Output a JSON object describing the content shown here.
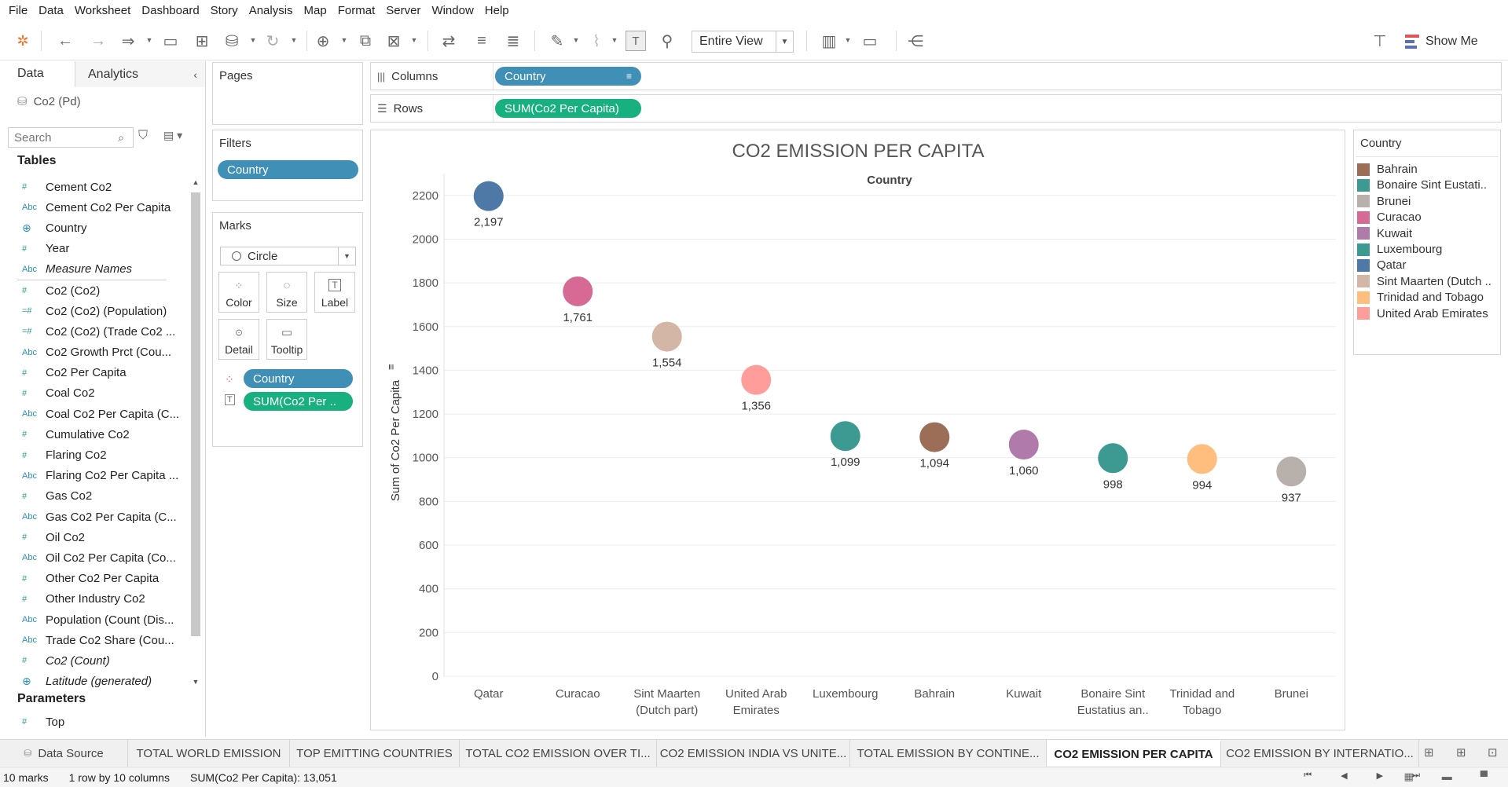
{
  "menu": [
    "File",
    "Data",
    "Worksheet",
    "Dashboard",
    "Story",
    "Analysis",
    "Map",
    "Format",
    "Server",
    "Window",
    "Help"
  ],
  "toolbar": {
    "view_select": "Entire View",
    "show_me": "Show Me"
  },
  "data_pane": {
    "tab_data": "Data",
    "tab_analytics": "Analytics",
    "datasource": "Co2 (Pd)",
    "search_placeholder": "Search",
    "tables_header": "Tables",
    "fields": [
      {
        "icon": "#",
        "type": "measure",
        "name": "Cement Co2"
      },
      {
        "icon": "Abc",
        "type": "string",
        "name": "Cement Co2 Per Capita"
      },
      {
        "icon": "geo",
        "type": "geo",
        "name": "Country"
      },
      {
        "icon": "#",
        "type": "measure",
        "name": "Year"
      },
      {
        "icon": "Abc",
        "type": "string",
        "name": "Measure Names",
        "italic": true
      },
      {
        "divider": true
      },
      {
        "icon": "#",
        "type": "measure",
        "name": "Co2 (Co2)"
      },
      {
        "icon": "=#",
        "type": "calc",
        "name": "Co2 (Co2) (Population)"
      },
      {
        "icon": "=#",
        "type": "calc",
        "name": "Co2 (Co2) (Trade Co2 ..."
      },
      {
        "icon": "Abc",
        "type": "string",
        "name": "Co2 Growth Prct (Cou..."
      },
      {
        "icon": "#",
        "type": "measure",
        "name": "Co2 Per Capita"
      },
      {
        "icon": "#",
        "type": "measure",
        "name": "Coal Co2"
      },
      {
        "icon": "Abc",
        "type": "string",
        "name": "Coal Co2 Per Capita (C..."
      },
      {
        "icon": "#",
        "type": "measure",
        "name": "Cumulative Co2"
      },
      {
        "icon": "#",
        "type": "measure",
        "name": "Flaring Co2"
      },
      {
        "icon": "Abc",
        "type": "string",
        "name": "Flaring Co2 Per Capita ..."
      },
      {
        "icon": "#",
        "type": "measure",
        "name": "Gas Co2"
      },
      {
        "icon": "Abc",
        "type": "string",
        "name": "Gas Co2 Per Capita (C..."
      },
      {
        "icon": "#",
        "type": "measure",
        "name": "Oil Co2"
      },
      {
        "icon": "Abc",
        "type": "string",
        "name": "Oil Co2 Per Capita (Co..."
      },
      {
        "icon": "#",
        "type": "measure",
        "name": "Other Co2 Per Capita"
      },
      {
        "icon": "#",
        "type": "measure",
        "name": "Other Industry Co2"
      },
      {
        "icon": "Abc",
        "type": "string",
        "name": "Population (Count (Dis..."
      },
      {
        "icon": "Abc",
        "type": "string",
        "name": "Trade Co2 Share (Cou..."
      },
      {
        "icon": "#",
        "type": "measure",
        "name": "Co2 (Count)",
        "italic": true
      },
      {
        "icon": "geo",
        "type": "geo",
        "name": "Latitude (generated)",
        "italic": true
      }
    ],
    "parameters_header": "Parameters",
    "parameters": [
      "Top"
    ]
  },
  "cards": {
    "pages_title": "Pages",
    "filters_title": "Filters",
    "filter_pill": "Country",
    "marks_title": "Marks",
    "mark_type": "Circle",
    "mark_buttons": [
      "Color",
      "Size",
      "Label",
      "Detail",
      "Tooltip"
    ],
    "mark_pills": [
      "Country",
      "SUM(Co2 Per .."
    ]
  },
  "shelves": {
    "columns_label": "Columns",
    "columns_pill": "Country",
    "rows_label": "Rows",
    "rows_pill": "SUM(Co2 Per Capita)"
  },
  "legend": {
    "title": "Country",
    "items": [
      {
        "name": "Bahrain",
        "color": "#9c6e58"
      },
      {
        "name": "Bonaire Sint Eustati..",
        "color": "#3d9a93"
      },
      {
        "name": "Brunei",
        "color": "#b8b0ab"
      },
      {
        "name": "Curacao",
        "color": "#d66a94"
      },
      {
        "name": "Kuwait",
        "color": "#b07aaa"
      },
      {
        "name": "Luxembourg",
        "color": "#3d9a93"
      },
      {
        "name": "Qatar",
        "color": "#4e79a7"
      },
      {
        "name": "Sint Maarten (Dutch ..",
        "color": "#d4b6a6"
      },
      {
        "name": "Trinidad and Tobago",
        "color": "#ffbe7d"
      },
      {
        "name": "United Arab Emirates",
        "color": "#ff9d9a"
      }
    ]
  },
  "chart_data": {
    "type": "scatter",
    "title": "CO2 EMISSION PER CAPITA",
    "column_header": "Country",
    "ylabel": "Sum of Co2 Per Capita",
    "ylim": [
      0,
      2300
    ],
    "yticks": [
      0,
      200,
      400,
      600,
      800,
      1000,
      1200,
      1400,
      1600,
      1800,
      2000,
      2200
    ],
    "categories": [
      [
        "Qatar"
      ],
      [
        "Curacao"
      ],
      [
        "Sint Maarten",
        "(Dutch part)"
      ],
      [
        "United Arab",
        "Emirates"
      ],
      [
        "Luxembourg"
      ],
      [
        "Bahrain"
      ],
      [
        "Kuwait"
      ],
      [
        "Bonaire Sint",
        "Eustatius an.."
      ],
      [
        "Trinidad and",
        "Tobago"
      ],
      [
        "Brunei"
      ]
    ],
    "values": [
      2197,
      1761,
      1554,
      1356,
      1099,
      1094,
      1060,
      998,
      994,
      937
    ],
    "value_labels": [
      "2,197",
      "1,761",
      "1,554",
      "1,356",
      "1,099",
      "1,094",
      "1,060",
      "998",
      "994",
      "937"
    ],
    "colors": [
      "#4e79a7",
      "#d66a94",
      "#d4b6a6",
      "#ff9d9a",
      "#3d9a93",
      "#9c6e58",
      "#b07aaa",
      "#3d9a93",
      "#ffbe7d",
      "#b8b0ab"
    ],
    "grid": true
  },
  "sheet_tabs": {
    "data_source": "Data Source",
    "tabs": [
      "TOTAL WORLD EMISSION",
      "TOP EMITTING COUNTRIES",
      "TOTAL CO2 EMISSION OVER TI...",
      "CO2 EMISSION INDIA VS UNITE...",
      "TOTAL EMISSION BY CONTINE...",
      "CO2 EMISSION PER CAPITA",
      "CO2 EMISSION BY INTERNATIO..."
    ],
    "active": "CO2 EMISSION PER CAPITA"
  },
  "status": {
    "marks": "10 marks",
    "dims": "1 row by 10 columns",
    "sum": "SUM(Co2 Per Capita): 13,051"
  }
}
